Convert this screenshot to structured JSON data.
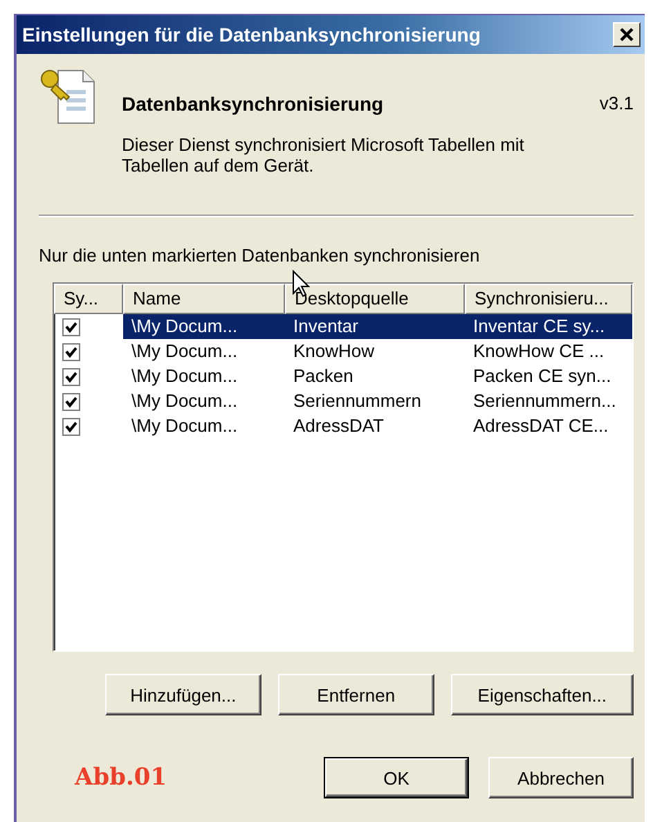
{
  "window": {
    "title": "Einstellungen für die Datenbanksynchronisierung"
  },
  "header": {
    "title": "Datenbanksynchronisierung",
    "version": "v3.1",
    "description": "Dieser Dienst synchronisiert Microsoft Tabellen mit Tabellen auf dem Gerät."
  },
  "list": {
    "label": "Nur die unten markierten Datenbanken synchronisieren",
    "columns": [
      "Sy...",
      "Name",
      "Desktopquelle",
      "Synchronisieru..."
    ],
    "rows": [
      {
        "checked": true,
        "selected": true,
        "cells": [
          "",
          "\\My Docum...",
          "Inventar",
          "Inventar CE sy..."
        ]
      },
      {
        "checked": true,
        "selected": false,
        "cells": [
          "",
          "\\My Docum...",
          "KnowHow",
          "KnowHow CE ..."
        ]
      },
      {
        "checked": true,
        "selected": false,
        "cells": [
          "",
          "\\My Docum...",
          "Packen",
          "Packen CE syn..."
        ]
      },
      {
        "checked": true,
        "selected": false,
        "cells": [
          "",
          "\\My Docum...",
          "Seriennummern",
          "Seriennummern..."
        ]
      },
      {
        "checked": true,
        "selected": false,
        "cells": [
          "",
          "\\My Docum...",
          "AdressDAT",
          "AdressDAT CE..."
        ]
      }
    ]
  },
  "list_buttons": [
    {
      "label": "Hinzufügen..."
    },
    {
      "label": "Entfernen"
    },
    {
      "label": "Eigenschaften..."
    }
  ],
  "figure_label": "Abb.01",
  "dialog_buttons": [
    {
      "label": "OK",
      "default": true
    },
    {
      "label": "Abbrechen",
      "default": false
    }
  ]
}
